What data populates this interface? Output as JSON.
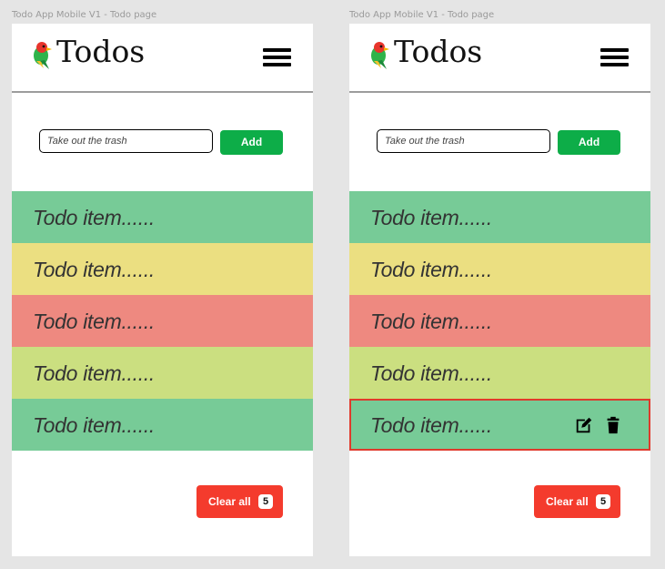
{
  "frames": [
    {
      "label": "Todo App Mobile V1 - Todo page",
      "app_title": "Todos",
      "input": {
        "placeholder": "Take out the trash"
      },
      "add_label": "Add",
      "todos": [
        {
          "text": "Todo item......",
          "color": "#77cb97"
        },
        {
          "text": "Todo item......",
          "color": "#ebdf81"
        },
        {
          "text": "Todo item......",
          "color": "#ee8980"
        },
        {
          "text": "Todo item......",
          "color": "#cbdf80"
        },
        {
          "text": "Todo item......",
          "color": "#77cb97"
        }
      ],
      "clear_label": "Clear all",
      "count": "5"
    },
    {
      "label": "Todo App Mobile V1 - Todo page",
      "app_title": "Todos",
      "input": {
        "placeholder": "Take out the trash"
      },
      "add_label": "Add",
      "todos": [
        {
          "text": "Todo item......",
          "color": "#77cb97"
        },
        {
          "text": "Todo item......",
          "color": "#ebdf81"
        },
        {
          "text": "Todo item......",
          "color": "#ee8980"
        },
        {
          "text": "Todo item......",
          "color": "#cbdf80"
        },
        {
          "text": "Todo item......",
          "color": "#77cb97",
          "selected": true,
          "actions": [
            "edit-icon",
            "trash-icon"
          ]
        }
      ],
      "clear_label": "Clear all",
      "count": "5"
    }
  ],
  "colors": {
    "add_button": "#0dad48",
    "clear_button": "#f43b2d",
    "selected_border": "#e03a2c"
  }
}
